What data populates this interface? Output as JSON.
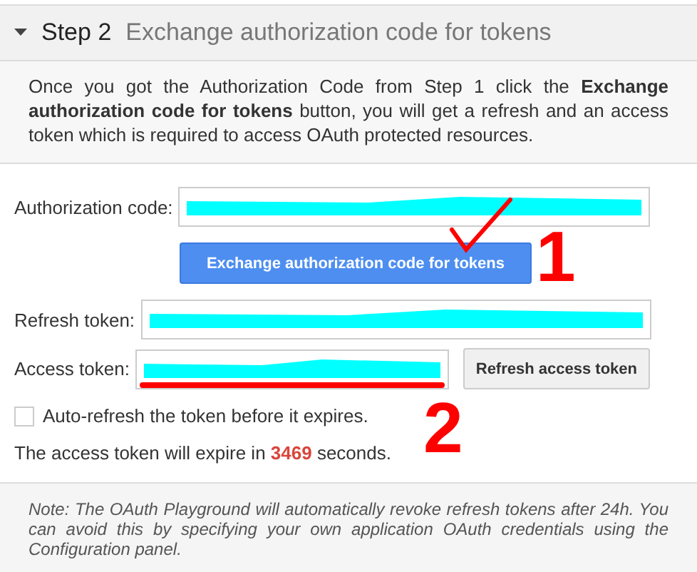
{
  "step": {
    "number": "Step 2",
    "title": "Exchange authorization code for tokens",
    "expanded": true
  },
  "description": "Once you got the Authorization Code from Step 1 click the **Exchange authorization code for tokens** button, you will get a refresh and an access token which is required to access OAuth protected resources.",
  "authorization_code": {
    "label": "Authorization code:"
  },
  "exchange_button": "Exchange authorization code for tokens",
  "refresh_token": {
    "label": "Refresh token:"
  },
  "access_token": {
    "label": "Access token:"
  },
  "refresh_button": "Refresh access token",
  "auto_refresh": {
    "label": "Auto-refresh the token before it expires.",
    "checked": false
  },
  "expiry": {
    "before": "The access token will expire in ",
    "seconds": "3469",
    "after": " seconds."
  },
  "annotations": [
    "1",
    "2"
  ],
  "note": "Note: The OAuth Playground will automatically revoke refresh tokens after 24h. You can avoid this by specifying your own application OAuth credentials using the Configuration panel."
}
